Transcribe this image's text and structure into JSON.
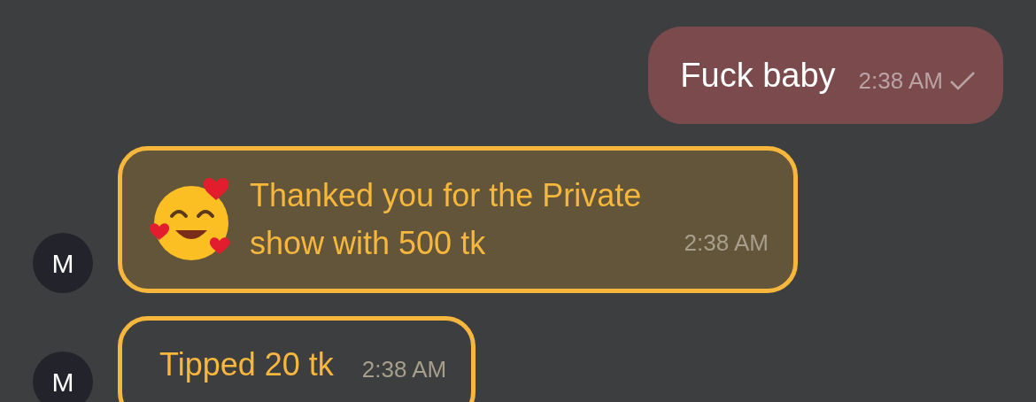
{
  "messages": [
    {
      "kind": "sent",
      "text": "Fuck baby",
      "time": "2:38 AM",
      "delivered": true
    },
    {
      "kind": "reaction",
      "avatar": "M",
      "text": "Thanked you for the Private show with 500 tk",
      "time": "2:38 AM"
    },
    {
      "kind": "tip",
      "avatar": "M",
      "text": "Tipped 20 tk",
      "time": "2:38 AM"
    }
  ]
}
